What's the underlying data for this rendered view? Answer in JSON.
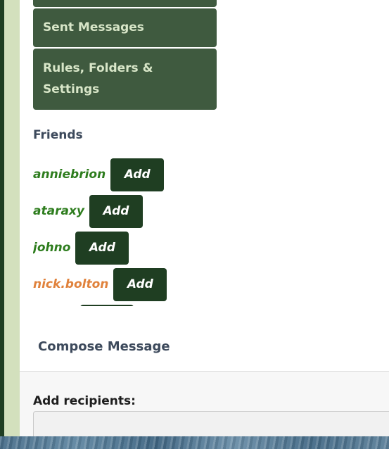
{
  "nav": {
    "sent_label": "Sent Messages",
    "rules_label": "Rules, Folders & Settings"
  },
  "friends": {
    "title": "Friends",
    "add_label": "Add",
    "items": [
      {
        "name": "anniebrion",
        "color": "#2e7d1e"
      },
      {
        "name": "ataraxy",
        "color": "#2e7d1e"
      },
      {
        "name": "johno",
        "color": "#2e7d1e"
      },
      {
        "name": "nick.bolton",
        "color": "#e0823c"
      }
    ]
  },
  "compose": {
    "title": "Compose Message",
    "recipients_label": "Add recipients:",
    "recipients_value": ""
  },
  "colors": {
    "nav_bg": "#3f5a3f",
    "nav_text": "#d8e6c8",
    "button_bg": "#1f3e22",
    "heading": "#3d4a5c"
  }
}
